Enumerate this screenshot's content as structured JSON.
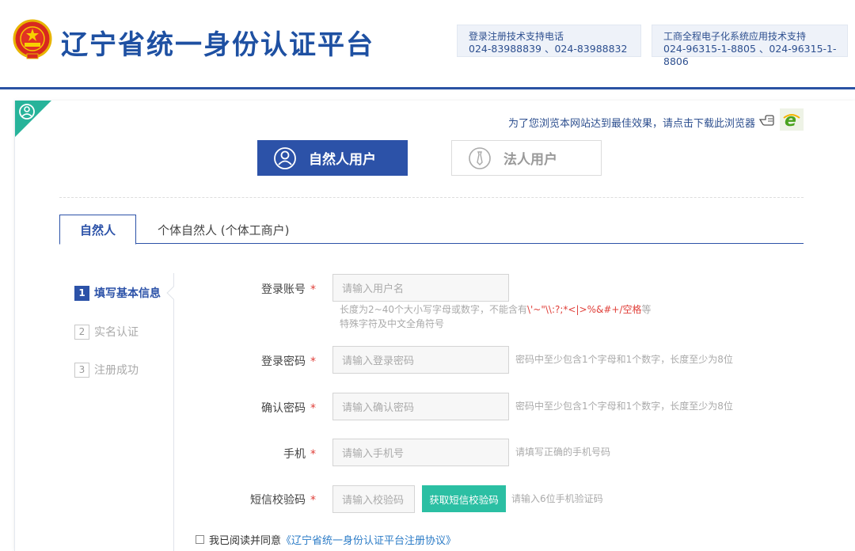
{
  "header": {
    "title": "辽宁省统一身份认证平台",
    "support_1": {
      "label": "登录注册技术支持电话",
      "value": "024-83988839 、024-83988832"
    },
    "support_2": {
      "label": "工商全程电子化系统应用技术支持",
      "value": "024-96315-1-8805 、024-96315-1-8806"
    }
  },
  "browser_tip": "为了您浏览本网站达到最佳效果，请点击下载此浏览器",
  "user_types": {
    "natural": "自然人用户",
    "legal": "法人用户"
  },
  "tabs": {
    "natural": "自然人",
    "individual": "个体自然人 (个体工商户)"
  },
  "steps": [
    {
      "num": "1",
      "label": "填写基本信息"
    },
    {
      "num": "2",
      "label": "实名认证"
    },
    {
      "num": "3",
      "label": "注册成功"
    }
  ],
  "form": {
    "account": {
      "label": "登录账号",
      "placeholder": "请输入用户名",
      "hint_prefix": "长度为2~40个大小写字母或数字，不能含有",
      "hint_red": "\\'~\"\\\\:?;*<|>%&#+/空格",
      "hint_suffix": "等",
      "hint_line2": "特殊字符及中文全角符号"
    },
    "password": {
      "label": "登录密码",
      "placeholder": "请输入登录密码",
      "hint": "密码中至少包含1个字母和1个数字，长度至少为8位"
    },
    "confirm": {
      "label": "确认密码",
      "placeholder": "请输入确认密码",
      "hint": "密码中至少包含1个字母和1个数字，长度至少为8位"
    },
    "phone": {
      "label": "手机",
      "placeholder": "请输入手机号",
      "hint": "请填写正确的手机号码"
    },
    "sms": {
      "label": "短信校验码",
      "placeholder": "请输入校验码",
      "button": "获取短信校验码",
      "hint": "请输入6位手机验证码"
    },
    "required_mark": "*"
  },
  "agreement": {
    "text": "我已阅读并同意",
    "link": "《辽宁省统一身份认证平台注册协议》"
  },
  "colors": {
    "primary": "#2c52a8",
    "accent": "#2bbfa3",
    "required": "#e0403a"
  }
}
